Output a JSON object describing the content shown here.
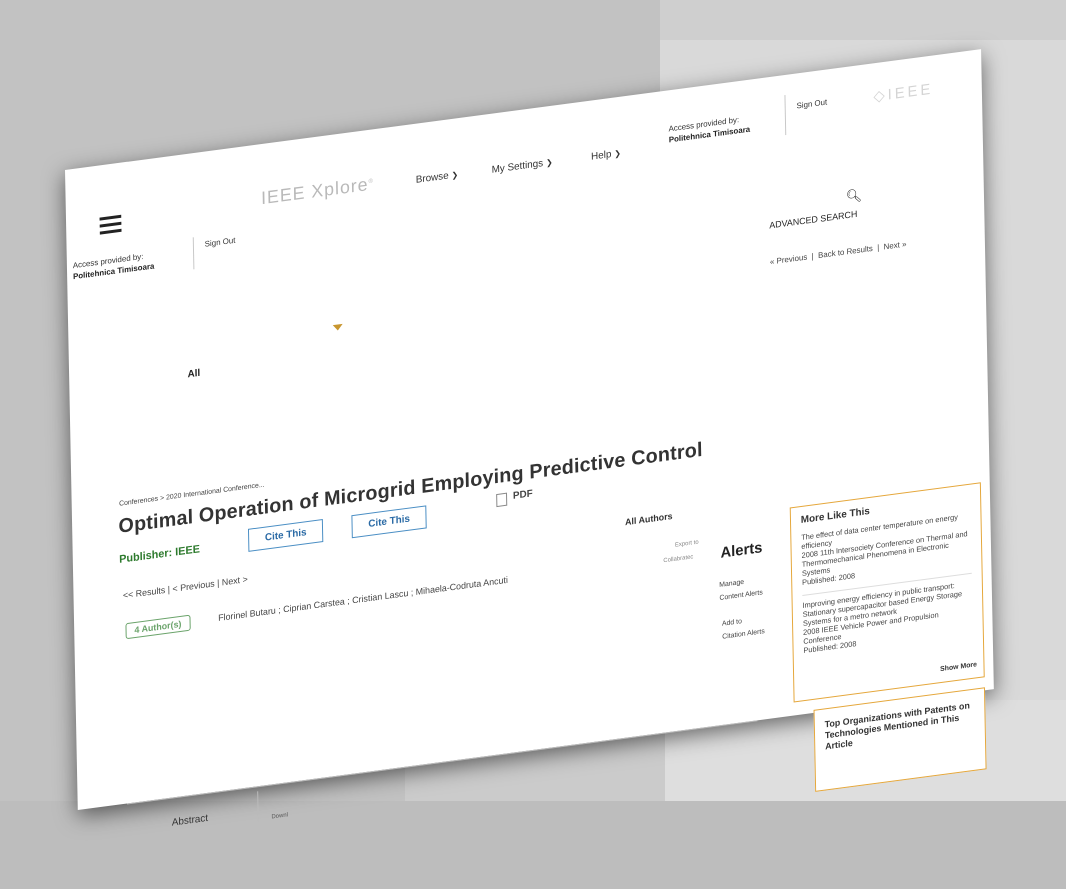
{
  "header": {
    "access_label": "Access provided by:",
    "access_institution": "Politehnica Timisoara",
    "sign_out": "Sign Out",
    "logo_text": "IEEE Xplore",
    "nav": [
      {
        "label": "Browse"
      },
      {
        "label": "My Settings"
      },
      {
        "label": "Help"
      }
    ],
    "ieee_mark": "◇IEEE"
  },
  "search": {
    "scope": "All",
    "advanced_label": "ADVANCED SEARCH",
    "icon": "search-icon"
  },
  "result_nav": {
    "previous": "« Previous",
    "back": "Back to Results",
    "next": "Next »",
    "separator": "|"
  },
  "article": {
    "breadcrumb": "Conferences  >  2020 International Conference...",
    "title": "Optimal Operation of Microgrid Employing Predictive Control",
    "publisher": "Publisher: IEEE",
    "cite_buttons": [
      "Cite This",
      "Cite This"
    ],
    "pdf_label": "PDF",
    "results_nav": "<< Results   |  < Previous   |   Next >",
    "all_authors": "All Authors",
    "authors_count": "4 Author(s)",
    "authors": "Florinel Butaru ; Ciprian Carstea ; Cristian Lascu ; Mihaela-Codruta Ancuti"
  },
  "alerts": {
    "export_label": "Export to",
    "collabratec": "Collabratec",
    "title": "Alerts",
    "manage_1": "Manage",
    "manage_2": "Content Alerts",
    "add_1": "Add to",
    "add_2": "Citation Alerts"
  },
  "more_like_this": {
    "heading": "More Like This",
    "items": [
      {
        "title": "The effect of data center temperature on energy efficiency",
        "venue": "2008 11th Intersociety Conference on Thermal and Thermomechanical Phenomena in Electronic Systems",
        "published": "Published: 2008"
      },
      {
        "title": "Improving energy efficiency in public transport: Stationary supercapacitor based Energy Storage Systems for a metro network",
        "venue": "2008 IEEE Vehicle Power and Propulsion Conference",
        "published": "Published: 2008"
      }
    ],
    "show_more": "Show More"
  },
  "top_orgs": {
    "heading": "Top Organizations with Patents on Technologies Mentioned in This Article"
  },
  "bottom_tabs": {
    "abstract": "Abstract",
    "download": "Downl"
  },
  "colors": {
    "publisher_green": "#2d7a2d",
    "cite_blue": "#2a6aa5",
    "box_orange": "#e5a73b",
    "caret_gold": "#c8962f"
  }
}
